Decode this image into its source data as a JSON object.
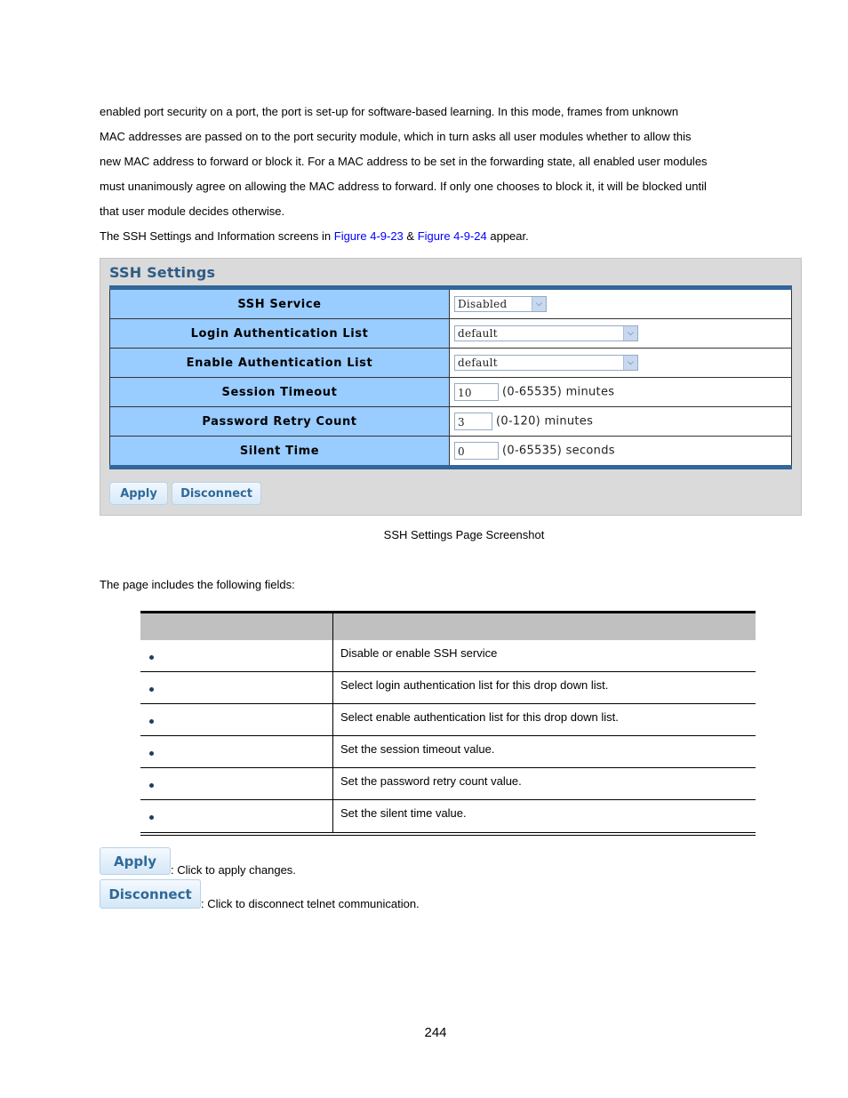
{
  "intro": {
    "lines": [
      "enabled port security on a port, the port is set-up for software-based learning. In this mode, frames from unknown",
      "MAC addresses are passed on to the port security module, which in turn asks all user modules whether to allow this",
      "new MAC address to forward or block it. For a MAC address to be set in the forwarding state, all enabled user modules",
      "must unanimously agree on allowing the MAC address to forward. If only one chooses to block it, it will be blocked until",
      "that user module decides otherwise."
    ],
    "figure_sentence": {
      "prefix": "The SSH Settings and Information screens in ",
      "link1": "Figure 4-9-23",
      "middle": " & ",
      "link2": "Figure 4-9-24",
      "suffix": " appear."
    }
  },
  "ssh_panel": {
    "title": "SSH Settings",
    "rows": [
      {
        "label": "SSH Service",
        "type": "select",
        "value": "Disabled"
      },
      {
        "label": "Login Authentication List",
        "type": "select",
        "value": "default"
      },
      {
        "label": "Enable Authentication List",
        "type": "select",
        "value": "default"
      },
      {
        "label": "Session Timeout",
        "type": "text",
        "value": "10",
        "hint": "(0-65535) minutes"
      },
      {
        "label": "Password Retry Count",
        "type": "text",
        "value": "3",
        "hint": "(0-120) minutes"
      },
      {
        "label": "Silent Time",
        "type": "text",
        "value": "0",
        "hint": "(0-65535) seconds"
      }
    ],
    "apply_label": "Apply",
    "disconnect_label": "Disconnect"
  },
  "caption": "SSH Settings Page Screenshot",
  "fields_intro": "The page includes the following fields:",
  "fields_table": {
    "headers": [
      "",
      ""
    ],
    "rows": [
      {
        "object": "",
        "description": "Disable or enable SSH service"
      },
      {
        "object": "",
        "description": "Select login authentication list for this drop down list."
      },
      {
        "object": "",
        "description": "Select enable authentication list for this drop down list."
      },
      {
        "object": "",
        "description": "Set the session timeout value."
      },
      {
        "object": "",
        "description": "Set the password retry count value."
      },
      {
        "object": "",
        "description": "Set the silent time value."
      }
    ]
  },
  "buttons_desc": {
    "apply_label": "Apply",
    "apply_text": ": Click to apply changes.",
    "disconnect_label": "Disconnect",
    "disconnect_text": ": Click to disconnect telnet communication."
  },
  "page_number": "244"
}
